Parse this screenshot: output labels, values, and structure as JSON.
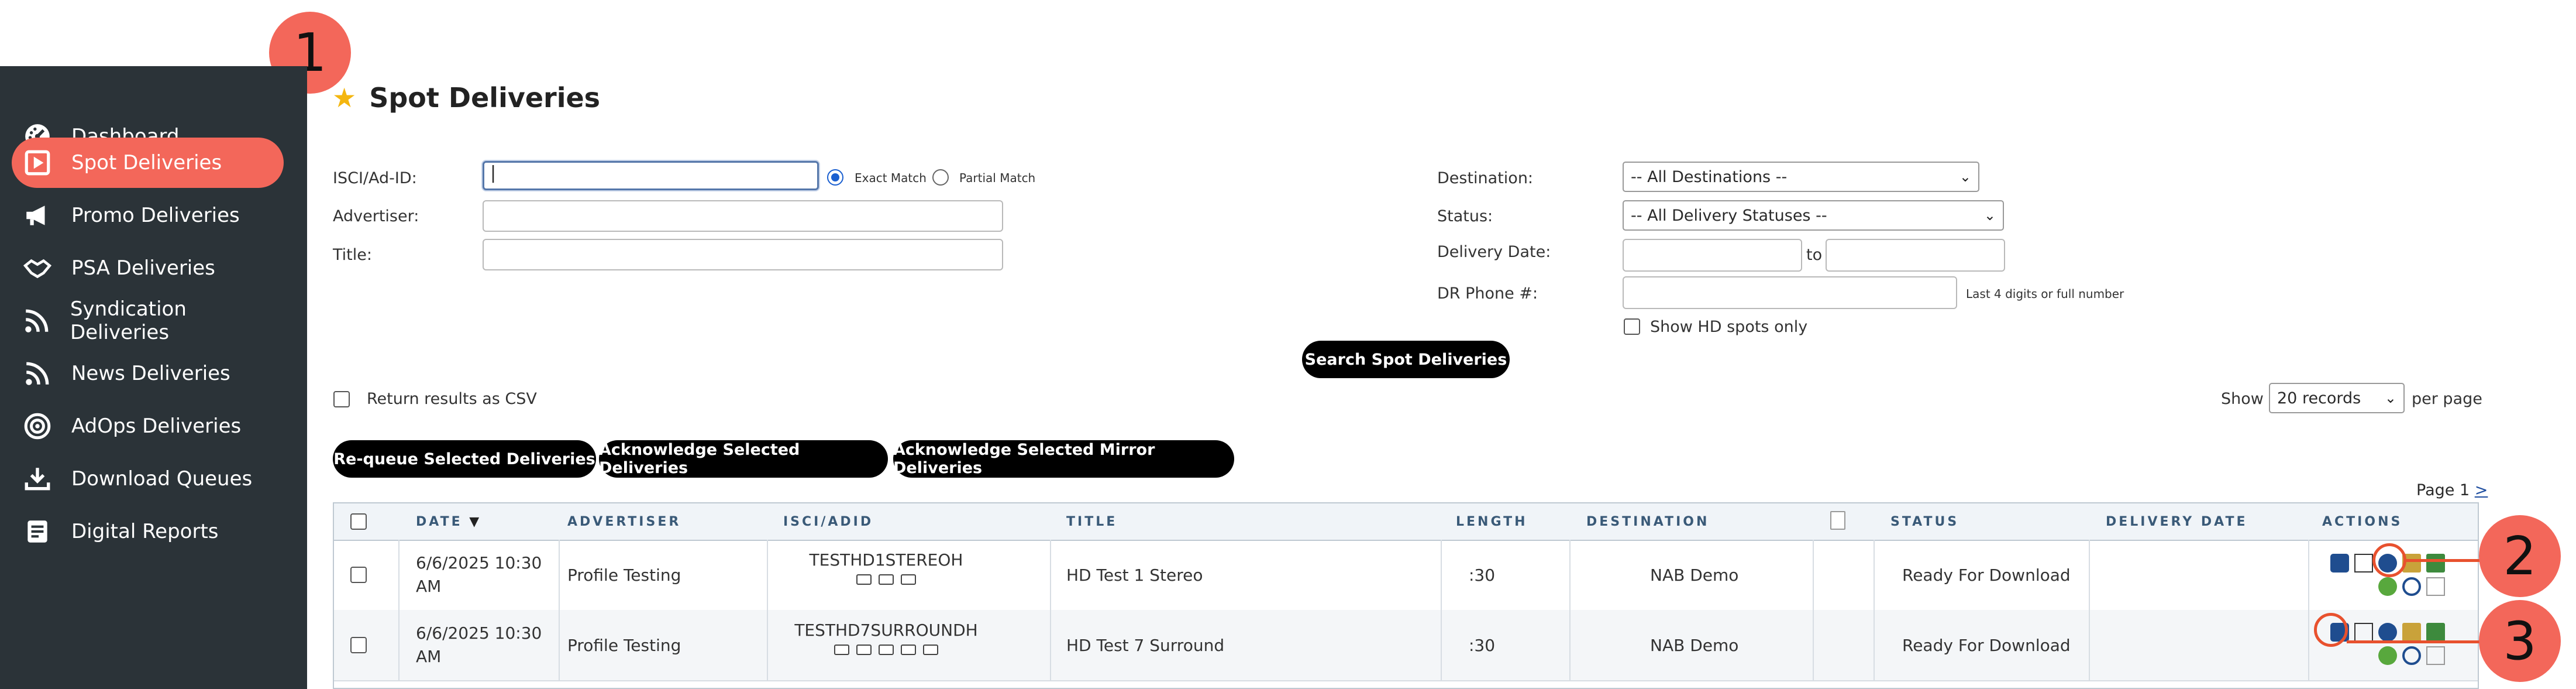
{
  "sidebar": {
    "items": [
      {
        "label": "Dashboard",
        "icon": "dashboard-gauge-icon"
      },
      {
        "label": "Spot Deliveries",
        "icon": "play-square-icon",
        "active": true
      },
      {
        "label": "Promo Deliveries",
        "icon": "megaphone-icon"
      },
      {
        "label": "PSA Deliveries",
        "icon": "handshake-icon"
      },
      {
        "label": "Syndication Deliveries",
        "icon": "rss-icon"
      },
      {
        "label": "News Deliveries",
        "icon": "rss-icon"
      },
      {
        "label": "AdOps Deliveries",
        "icon": "target-icon"
      },
      {
        "label": "Download Queues",
        "icon": "download-icon"
      },
      {
        "label": "Digital Reports",
        "icon": "report-icon"
      }
    ]
  },
  "page": {
    "title": "Spot Deliveries"
  },
  "form": {
    "isci_label": "ISCI/Ad-ID:",
    "exact_match": "Exact Match",
    "partial_match": "Partial Match",
    "advertiser_label": "Advertiser:",
    "title_label": "Title:",
    "destination_label": "Destination:",
    "destination_value": "-- All Destinations --",
    "status_label": "Status:",
    "status_value": "-- All Delivery Statuses --",
    "delivery_date_label": "Delivery Date:",
    "to_label": "to",
    "dr_phone_label": "DR Phone #:",
    "dr_phone_hint": "Last 4 digits or full number",
    "hd_only_label": "Show HD spots only",
    "search_button": "Search Spot Deliveries",
    "csv_label": "Return results as CSV",
    "show_label": "Show",
    "records_value": "20 records",
    "per_page_label": "per page"
  },
  "actions": {
    "requeue": "Re-queue Selected Deliveries",
    "acknowledge": "Acknowledge Selected Deliveries",
    "acknowledge_mirror": "Acknowledge Selected Mirror Deliveries"
  },
  "pagination": {
    "label": "Page 1",
    "next": ">"
  },
  "table": {
    "headers": {
      "date": "DATE",
      "date_sort": "▼",
      "advertiser": "ADVERTISER",
      "isci": "ISCI/ADID",
      "title": "TITLE",
      "length": "LENGTH",
      "destination": "DESTINATION",
      "status": "STATUS",
      "delivery_date": "DELIVERY DATE",
      "actions": "ACTIONS"
    },
    "rows": [
      {
        "date_l1": "6/6/2025 10:30",
        "date_l2": "AM",
        "advertiser": "Profile Testing",
        "isci": "TESTHD1STEREOH",
        "title": "HD Test 1 Stereo",
        "length": ":30",
        "destination": "NAB Demo",
        "status": "Ready For Download",
        "delivery_date": ""
      },
      {
        "date_l1": "6/6/2025 10:30",
        "date_l2": "AM",
        "advertiser": "Profile Testing",
        "isci": "TESTHD7SURROUNDH",
        "title": "HD Test 7 Surround",
        "length": ":30",
        "destination": "NAB Demo",
        "status": "Ready For Download",
        "delivery_date": ""
      }
    ]
  },
  "callouts": {
    "one": "1",
    "two": "2",
    "three": "3"
  },
  "colors": {
    "sidebar": "#2b3338",
    "accent": "#f3675a",
    "header_text": "#3a5a78",
    "callout_ring": "#e8512e"
  }
}
